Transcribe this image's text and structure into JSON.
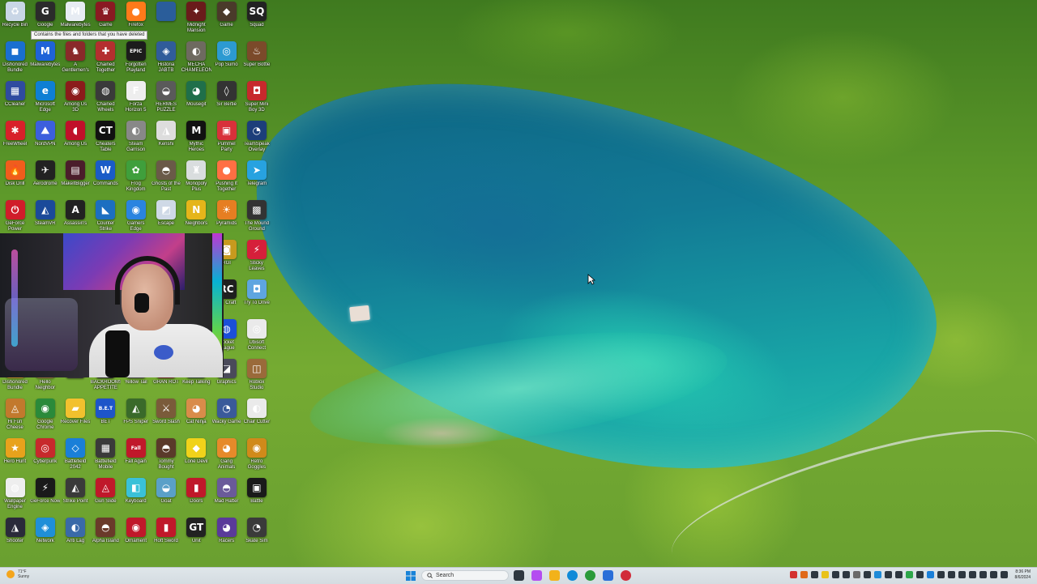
{
  "tooltip": "Contains the files and folders that you have deleted",
  "desktop_icons": [
    {
      "label": "Recycle Bin",
      "color": "#c9d6e6",
      "glyph": "♻"
    },
    {
      "label": "Google",
      "color": "#2b2b2b",
      "glyph": "G"
    },
    {
      "label": "Malwarebytes",
      "color": "#e7ecf3",
      "glyph": "M"
    },
    {
      "label": "Game",
      "color": "#8a1a22",
      "glyph": "♛"
    },
    {
      "label": "Firefox",
      "color": "#ff7a1a",
      "glyph": "●"
    },
    {
      "label": "",
      "color": "#2a5d9a",
      "glyph": ""
    },
    {
      "label": "Midnight Mansion",
      "color": "#6a1b1b",
      "glyph": "✦"
    },
    {
      "label": "Game",
      "color": "#4a3a2a",
      "glyph": "◆"
    },
    {
      "label": "Squad",
      "color": "#222",
      "glyph": "SQ"
    },
    {
      "label": "Dishonored Bundle",
      "color": "#1a6fd0",
      "glyph": "◼"
    },
    {
      "label": "Malwarebytes",
      "color": "#1f63d8",
      "glyph": "M"
    },
    {
      "label": "A Gentlemen's",
      "color": "#8a2a2a",
      "glyph": "♞"
    },
    {
      "label": "Chained Together",
      "color": "#b42f2f",
      "glyph": "✚"
    },
    {
      "label": "Forgotten Playland",
      "color": "#1c1c1c",
      "glyph": "EPIC"
    },
    {
      "label": "Historia JABTB",
      "color": "#305c9a",
      "glyph": "◈"
    },
    {
      "label": "MECHA CHAMELEON",
      "color": "#6e6a60",
      "glyph": "◐"
    },
    {
      "label": "Pop Sumo",
      "color": "#2c9ad1",
      "glyph": "◎"
    },
    {
      "label": "Super Bottle",
      "color": "#7b4a2a",
      "glyph": "♨"
    },
    {
      "label": "CCleaner",
      "color": "#2f4ba0",
      "glyph": "▦"
    },
    {
      "label": "Microsoft Edge",
      "color": "#0e7fd4",
      "glyph": "e"
    },
    {
      "label": "Among Us 3D",
      "color": "#8b1b1b",
      "glyph": "◉"
    },
    {
      "label": "Chained Wheels",
      "color": "#3a3a3a",
      "glyph": "◍"
    },
    {
      "label": "Forza Horizon 5",
      "color": "#eeeeee",
      "glyph": "F"
    },
    {
      "label": "HERMES PUZZLE",
      "color": "#5a5a5a",
      "glyph": "◒"
    },
    {
      "label": "Mousegit",
      "color": "#1f6f4a",
      "glyph": "◕"
    },
    {
      "label": "Sir Bertie",
      "color": "#333",
      "glyph": "◊"
    },
    {
      "label": "Super Mini Boy 3D",
      "color": "#c7292c",
      "glyph": "◘"
    },
    {
      "label": "FreeWheel",
      "color": "#d8202a",
      "glyph": "✱"
    },
    {
      "label": "NordVPN",
      "color": "#3c5fdd",
      "glyph": "⛰"
    },
    {
      "label": "Among Us",
      "color": "#c0102a",
      "glyph": "◖"
    },
    {
      "label": "Cheaters Table",
      "color": "#111",
      "glyph": "CT"
    },
    {
      "label": "Steam Garrison",
      "color": "#888",
      "glyph": "◐"
    },
    {
      "label": "Kenshi",
      "color": "#dddddd",
      "glyph": "◮"
    },
    {
      "label": "Mythic Heroes",
      "color": "#111",
      "glyph": "M"
    },
    {
      "label": "Pummel Party",
      "color": "#d8313a",
      "glyph": "▣"
    },
    {
      "label": "TeamSpeak Overlay",
      "color": "#1c3e7a",
      "glyph": "◔"
    },
    {
      "label": "Disk Drill",
      "color": "#f05d1c",
      "glyph": "🔥"
    },
    {
      "label": "Aerodrome",
      "color": "#222",
      "glyph": "✈"
    },
    {
      "label": "MakeItBigger",
      "color": "#4b1d2b",
      "glyph": "▤"
    },
    {
      "label": "Commands",
      "color": "#1a5cc7",
      "glyph": "W"
    },
    {
      "label": "Frog Kingdom",
      "color": "#3f9f3c",
      "glyph": "✿"
    },
    {
      "label": "Ghosts of the Past",
      "color": "#6a5a48",
      "glyph": "◓"
    },
    {
      "label": "Monopoly Plus",
      "color": "#d9ddde",
      "glyph": "♜"
    },
    {
      "label": "Pushing It Together",
      "color": "#ff6f43",
      "glyph": "●"
    },
    {
      "label": "Telegram",
      "color": "#27a2e0",
      "glyph": "➤"
    },
    {
      "label": "GeForce Power",
      "color": "#d01d2a",
      "glyph": "⏻"
    },
    {
      "label": "SteamVR",
      "color": "#1b4a9a",
      "glyph": "◭"
    },
    {
      "label": "Assassin's",
      "color": "#222",
      "glyph": "A"
    },
    {
      "label": "Counter Strike",
      "color": "#1c6fc1",
      "glyph": "◣"
    },
    {
      "label": "Gamers Edge",
      "color": "#2a84e0",
      "glyph": "◉"
    },
    {
      "label": "Escape",
      "color": "#cfd9e6",
      "glyph": "◩"
    },
    {
      "label": "Neighbors",
      "color": "#e5b51a",
      "glyph": "N"
    },
    {
      "label": "Pyramids",
      "color": "#e67e22",
      "glyph": "☀"
    },
    {
      "label": "The Mound Ground",
      "color": "#333",
      "glyph": "▩"
    },
    {
      "label": "RGI",
      "color": "#c79a1e",
      "glyph": "◙"
    },
    {
      "label": "Sticky Leaves",
      "color": "#d61f3a",
      "glyph": "⚡"
    },
    {
      "label": "RC Craft",
      "color": "#1f1f1f",
      "glyph": "RC"
    },
    {
      "label": "Try To Drive",
      "color": "#5ea5e0",
      "glyph": "◘"
    },
    {
      "label": "Rocket League",
      "color": "#1b4fd8",
      "glyph": "◍"
    },
    {
      "label": "Ubisoft Connect",
      "color": "#eaeaea",
      "glyph": "◎"
    },
    {
      "label": "Dishonored Bundle",
      "color": "#b7892a",
      "glyph": "◆"
    },
    {
      "label": "Hello Neighbor",
      "color": "#8a6a3a",
      "glyph": "◕"
    },
    {
      "label": "",
      "color": "#333",
      "glyph": ""
    },
    {
      "label": "BACKROOMS APPETITE",
      "color": "#2a2a2a",
      "glyph": "▥"
    },
    {
      "label": "Yellow Tail",
      "color": "#4a4a4a",
      "glyph": "◐"
    },
    {
      "label": "GRAN ROT",
      "color": "#6a2a2a",
      "glyph": "▧"
    },
    {
      "label": "Keep Talking",
      "color": "#3a4a3a",
      "glyph": "◓"
    },
    {
      "label": "Graphics",
      "color": "#4a4a5a",
      "glyph": "◪"
    },
    {
      "label": "Roblox Studio",
      "color": "#9a6a3a",
      "glyph": "◫"
    },
    {
      "label": "Hi Fun Cheese",
      "color": "#c2792d",
      "glyph": "◬"
    },
    {
      "label": "Google Chrome",
      "color": "#2a8a3a",
      "glyph": "◉"
    },
    {
      "label": "Recover Files",
      "color": "#f2c12e",
      "glyph": "▰"
    },
    {
      "label": "BET",
      "color": "#1e55c9",
      "glyph": "B.E.T"
    },
    {
      "label": "FPS Sniper",
      "color": "#3a6a2a",
      "glyph": "◭"
    },
    {
      "label": "Sword Slash",
      "color": "#7a5b3a",
      "glyph": "⚔"
    },
    {
      "label": "Cat Ninja",
      "color": "#d98c4a",
      "glyph": "◕"
    },
    {
      "label": "Wacky Game",
      "color": "#3a5a9a",
      "glyph": "◔"
    },
    {
      "label": "Chair Cutter",
      "color": "#eaeaea",
      "glyph": "◐"
    },
    {
      "label": "Hero Hunt",
      "color": "#e8a21c",
      "glyph": "★"
    },
    {
      "label": "Cyberpunk",
      "color": "#c7292c",
      "glyph": "◎"
    },
    {
      "label": "Battlefield 2042",
      "color": "#1a7fd8",
      "glyph": "◇"
    },
    {
      "label": "Battlefield Mobile",
      "color": "#3a3a3a",
      "glyph": "▦"
    },
    {
      "label": "Fall Again",
      "color": "#c0182a",
      "glyph": "Fall"
    },
    {
      "label": "Tommy Bought",
      "color": "#5a3a2a",
      "glyph": "◓"
    },
    {
      "label": "Lone Devil",
      "color": "#f0d21a",
      "glyph": "◆"
    },
    {
      "label": "Gang Animals",
      "color": "#e68a2a",
      "glyph": "◕"
    },
    {
      "label": "Retro Goggles",
      "color": "#d08a1a",
      "glyph": "◉"
    },
    {
      "label": "Wallpaper Engine",
      "color": "#eeeeee",
      "glyph": "◍"
    },
    {
      "label": "GeForce Now",
      "color": "#1a1a1a",
      "glyph": "⚡"
    },
    {
      "label": "Strike Point",
      "color": "#3a3a3a",
      "glyph": "◭"
    },
    {
      "label": "Gun Slide",
      "color": "#c0182a",
      "glyph": "◬"
    },
    {
      "label": "Keyboard",
      "color": "#3ac1d8",
      "glyph": "◧"
    },
    {
      "label": "Goat",
      "color": "#5aa0c8",
      "glyph": "◒"
    },
    {
      "label": "Doors",
      "color": "#c0182a",
      "glyph": "▮"
    },
    {
      "label": "Mad Hatter",
      "color": "#6a5a9a",
      "glyph": "◓"
    },
    {
      "label": "Battle",
      "color": "#1a1a1a",
      "glyph": "▣"
    },
    {
      "label": "Shooter",
      "color": "#2a2a3a",
      "glyph": "◮"
    },
    {
      "label": "Network",
      "color": "#1f8fd8",
      "glyph": "◈"
    },
    {
      "label": "Anti Lag",
      "color": "#3a6aa8",
      "glyph": "◐"
    },
    {
      "label": "Alpha Island",
      "color": "#6a3a2a",
      "glyph": "◓"
    },
    {
      "label": "Ornament",
      "color": "#c0182a",
      "glyph": "◉"
    },
    {
      "label": "Hott Sword",
      "color": "#c0182a",
      "glyph": "▮"
    },
    {
      "label": "Unit",
      "color": "#222",
      "glyph": "GT"
    },
    {
      "label": "Racers",
      "color": "#5a3a9a",
      "glyph": "◕"
    },
    {
      "label": "Skate Sim",
      "color": "#3a3a3a",
      "glyph": "◔"
    },
    {
      "label": "Shotgun",
      "color": "#7a1a1a",
      "glyph": "◭"
    }
  ],
  "taskbar": {
    "weather_temp": "71°F",
    "weather_desc": "Sunny",
    "search_placeholder": "Search",
    "clock_time": "8:36 PM",
    "clock_date": "8/6/2024",
    "apps": [
      {
        "name": "task-view",
        "color": "#2d3740"
      },
      {
        "name": "copilot",
        "color": "#b44df0"
      },
      {
        "name": "file-explorer",
        "color": "#f2b21a"
      },
      {
        "name": "edge",
        "color": "#0e8ad8"
      },
      {
        "name": "chrome",
        "color": "#2a9a3a"
      },
      {
        "name": "store",
        "color": "#2a6fd8"
      },
      {
        "name": "app-red",
        "color": "#d12b3a"
      }
    ],
    "tray": [
      "#d3312f",
      "#e06a1a",
      "#2d3740",
      "#e8c21a",
      "#2d3740",
      "#2d3740",
      "#6a6a6a",
      "#2d3740",
      "#1e8bd8",
      "#2d3740",
      "#2d3740",
      "#2da64a",
      "#2d3740",
      "#1a7fd8",
      "#2d3740",
      "#2d3740",
      "#2d3740",
      "#2d3740",
      "#2d3740",
      "#2d3740",
      "#2d3740"
    ]
  }
}
